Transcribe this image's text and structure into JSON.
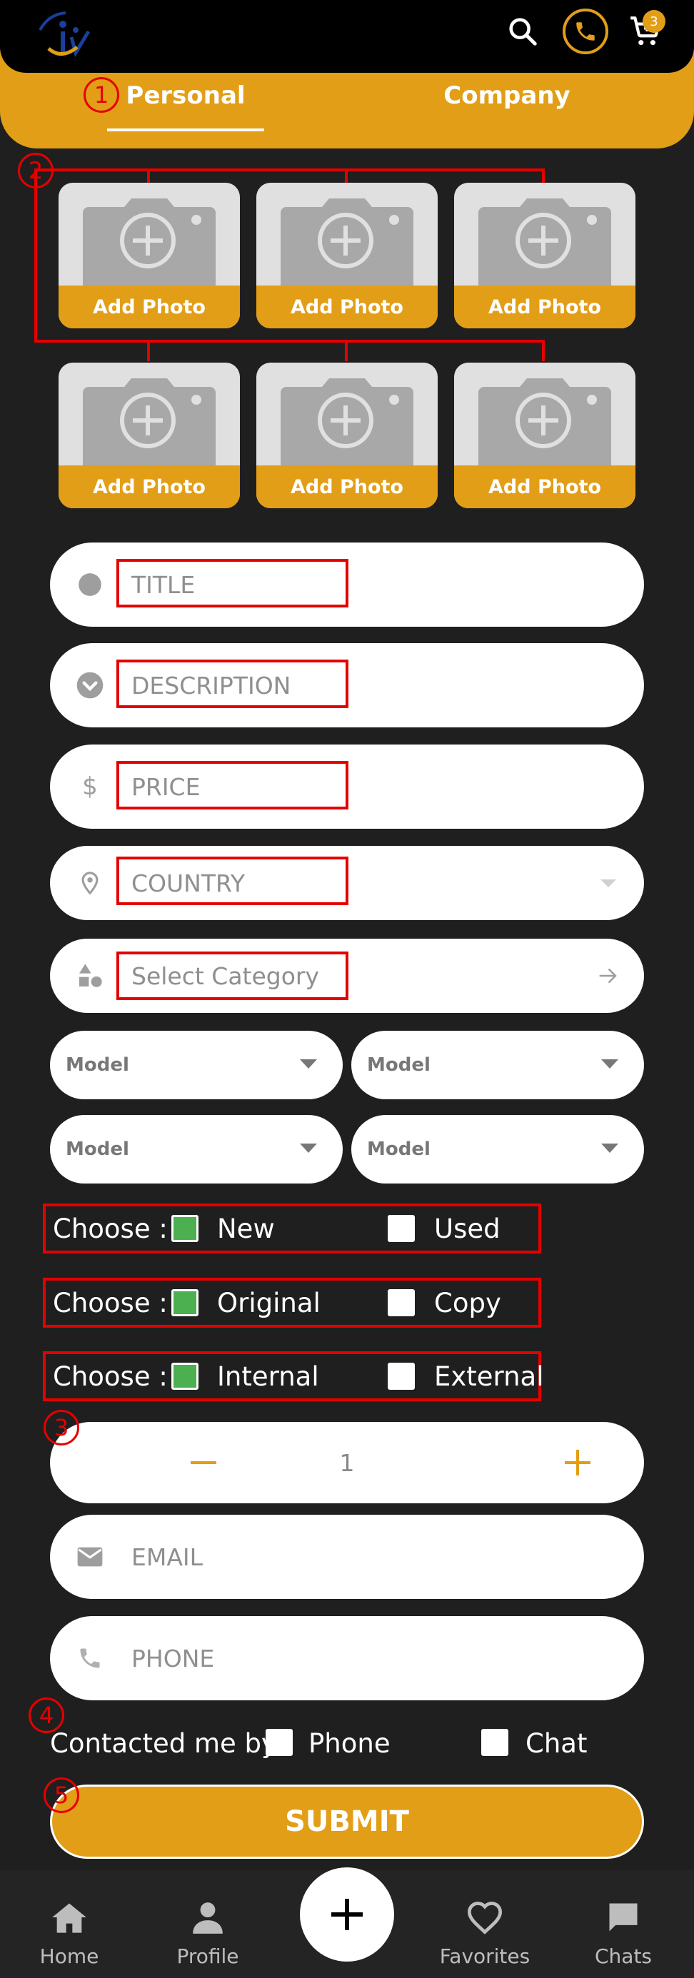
{
  "header": {
    "cart_count": "3"
  },
  "tabs": [
    {
      "label": "Personal",
      "active": true
    },
    {
      "label": "Company",
      "active": false
    }
  ],
  "markers": [
    "1",
    "2",
    "3",
    "4",
    "5"
  ],
  "photos": {
    "add_label": "Add Photo",
    "tiles": [
      "Add Photo",
      "Add Photo",
      "Add Photo",
      "Add Photo",
      "Add Photo",
      "Add Photo"
    ]
  },
  "form": {
    "title_placeholder": "TITLE",
    "description_placeholder": "DESCRIPTION",
    "price_placeholder": "PRICE",
    "country_placeholder": "COUNTRY",
    "category_placeholder": "Select Category",
    "model_labels": [
      "Model",
      "Model",
      "Model",
      "Model"
    ],
    "choose_label": "Choose :",
    "condition": {
      "option_a": "New",
      "option_b": "Used",
      "a_checked": true,
      "b_checked": false
    },
    "authenticity": {
      "option_a": "Original",
      "option_b": "Copy",
      "a_checked": true,
      "b_checked": false
    },
    "origin": {
      "option_a": "Internal",
      "option_b": "External",
      "a_checked": true,
      "b_checked": false
    },
    "quantity": "1",
    "email_placeholder": "EMAIL",
    "phone_placeholder": "PHONE",
    "contact_label": "Contacted me by :",
    "contact_phone": "Phone",
    "contact_chat": "Chat",
    "submit_label": "SUBMIT"
  },
  "bottom_nav": {
    "home": "Home",
    "profile": "Profile",
    "favorites": "Favorites",
    "chats": "Chats"
  },
  "colors": {
    "accent": "#e29e16",
    "background": "#1f1f1f",
    "annotation": "#e50000",
    "checked": "#4caf50"
  }
}
